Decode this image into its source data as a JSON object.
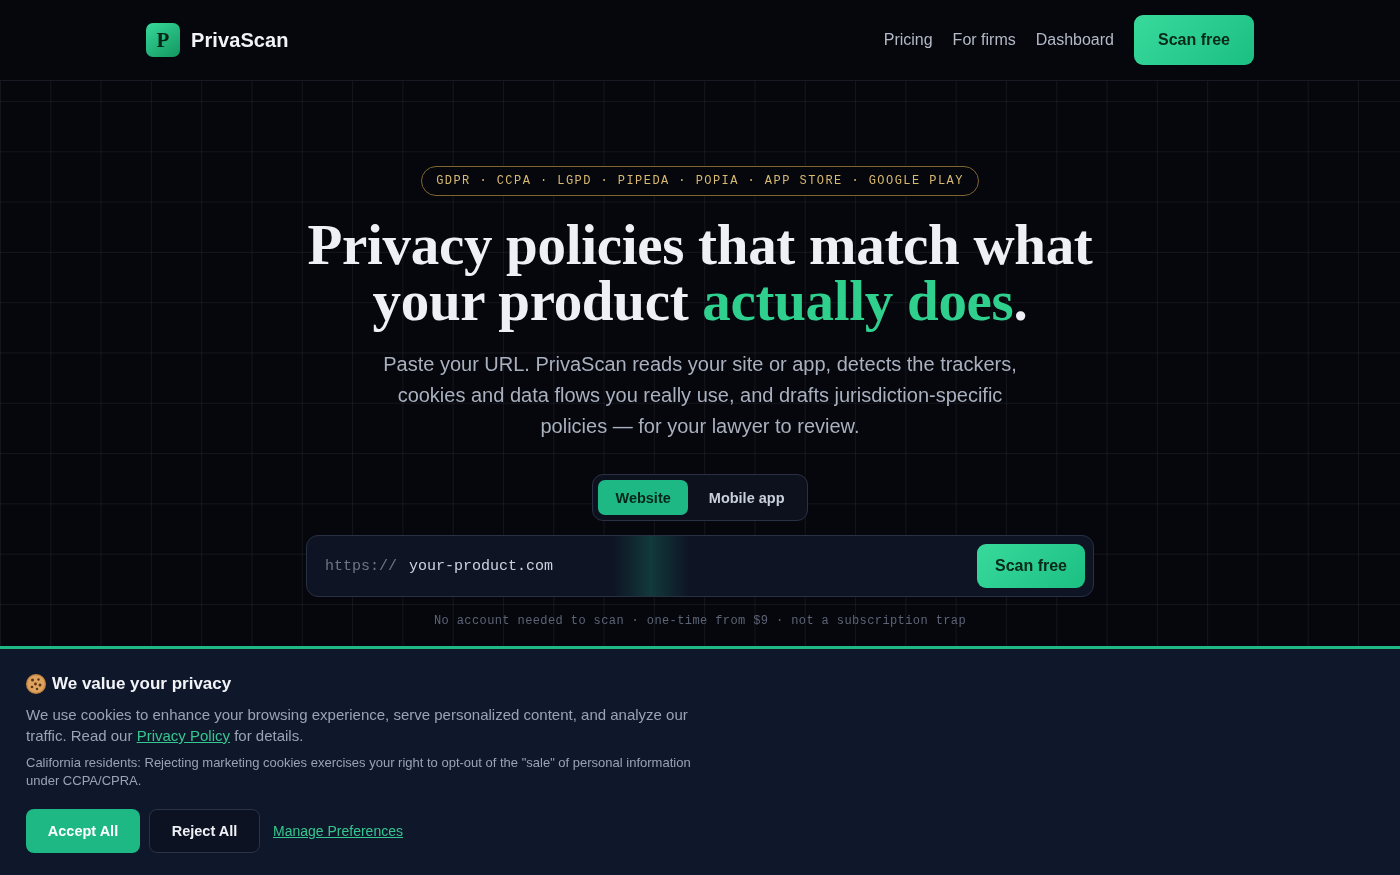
{
  "header": {
    "logo_letter": "P",
    "brand": "PrivaScan",
    "nav": [
      {
        "label": "Pricing"
      },
      {
        "label": "For firms"
      },
      {
        "label": "Dashboard"
      }
    ],
    "cta": "Scan free"
  },
  "hero": {
    "regulations": "GDPR · CCPA · LGPD · PIPEDA · POPIA · APP STORE · GOOGLE PLAY",
    "headline": [
      {
        "text": "Privacy policies that match what your product ",
        "highlight": false
      },
      {
        "text": "actually does",
        "highlight": true
      },
      {
        "text": ".",
        "highlight": false
      }
    ],
    "subtitle": "Paste your URL. PrivaScan reads your site or app, detects the trackers, cookies and data flows you really use, and drafts jurisdiction-specific policies — for your lawyer to review.",
    "mode_tabs": [
      {
        "label": "Website",
        "selected": true
      },
      {
        "label": "Mobile app",
        "selected": false
      }
    ],
    "url_field": {
      "prefix": "https://",
      "value": "your-product.com"
    },
    "scan_button": "Scan free",
    "note": "No account needed to scan · one-time from $9 · not a subscription trap"
  },
  "cookie_banner": {
    "title": "We value your privacy",
    "message": {
      "before": "We use cookies to enhance your browsing experience, serve personalized content, and analyze our traffic. Read our",
      "link": "Privacy Policy",
      "after": "for details."
    },
    "notice": "California residents: Rejecting marketing cookies exercises your right to opt-out of the \"sale\" of personal information under CCPA/CPRA.",
    "actions": [
      {
        "label": "Accept All",
        "kind": "primary"
      },
      {
        "label": "Reject All",
        "kind": "secondary"
      },
      {
        "label": "Manage Preferences",
        "kind": "link"
      }
    ]
  }
}
